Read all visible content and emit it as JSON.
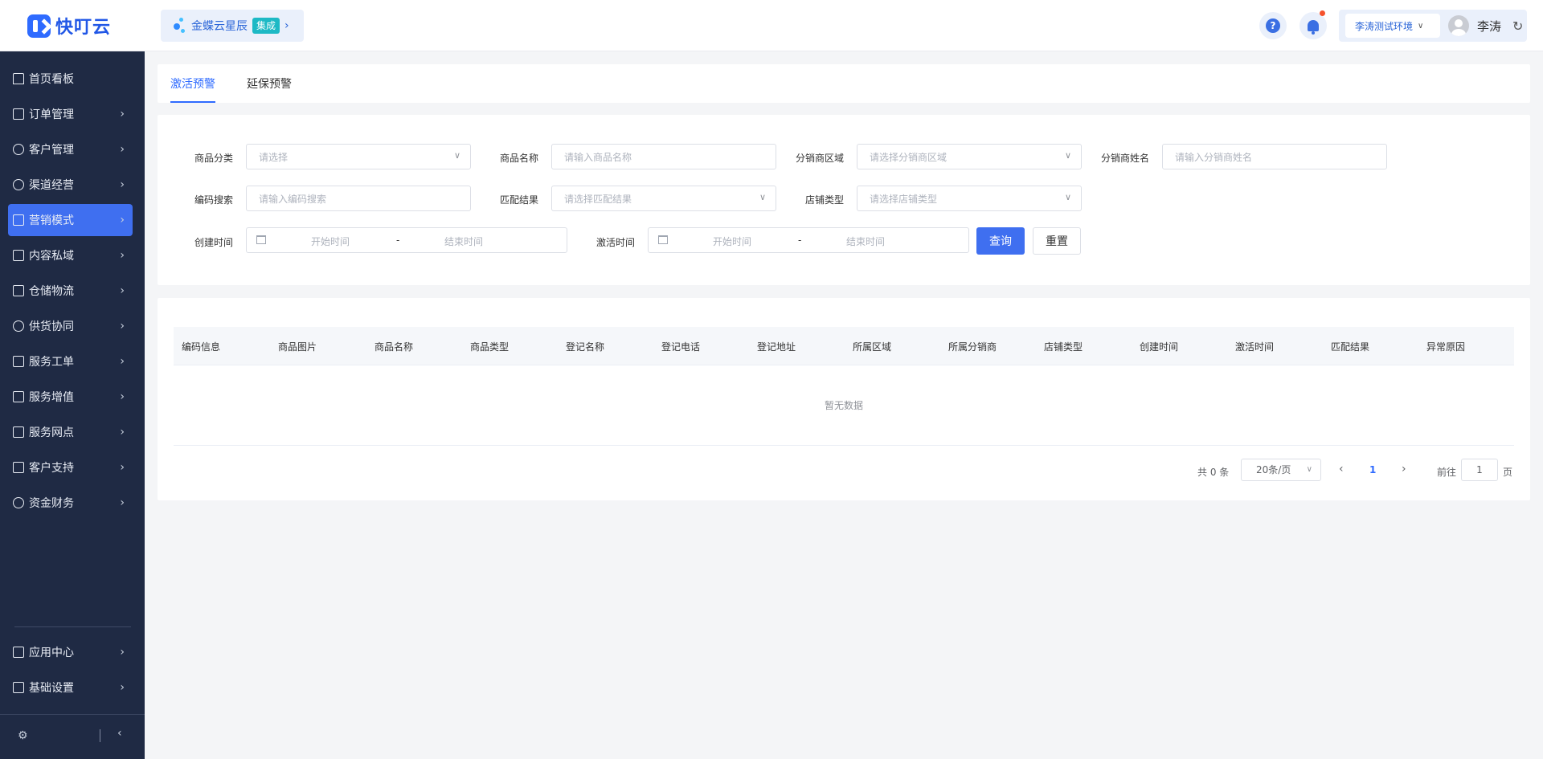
{
  "header": {
    "logo_text": "快叮云",
    "app_name": "金蝶云星辰",
    "app_tag": "集成",
    "env": "李涛测试环境",
    "username": "李涛"
  },
  "sidebar": {
    "items": [
      {
        "label": "首页看板",
        "icon": "home-icon"
      },
      {
        "label": "订单管理",
        "icon": "order-icon"
      },
      {
        "label": "客户管理",
        "icon": "user-icon"
      },
      {
        "label": "渠道经营",
        "icon": "channel-icon"
      },
      {
        "label": "营销模式",
        "icon": "tag-icon"
      },
      {
        "label": "内容私域",
        "icon": "image-icon"
      },
      {
        "label": "仓储物流",
        "icon": "box-icon"
      },
      {
        "label": "供货协同",
        "icon": "supply-icon"
      },
      {
        "label": "服务工单",
        "icon": "ticket-icon"
      },
      {
        "label": "服务增值",
        "icon": "bag-icon"
      },
      {
        "label": "服务网点",
        "icon": "store-icon"
      },
      {
        "label": "客户支持",
        "icon": "support-icon"
      },
      {
        "label": "资金财务",
        "icon": "yuan-icon"
      }
    ],
    "bottom_items": [
      {
        "label": "应用中心",
        "icon": "cube-icon"
      },
      {
        "label": "基础设置",
        "icon": "settings-icon"
      }
    ],
    "active_index": 4
  },
  "tabs": [
    "激活预警",
    "延保预警"
  ],
  "filters": {
    "category": {
      "label": "商品分类",
      "placeholder": "请选择"
    },
    "product_name": {
      "label": "商品名称",
      "placeholder": "请输入商品名称"
    },
    "region": {
      "label": "分销商区域",
      "placeholder": "请选择分销商区域"
    },
    "distributor_name": {
      "label": "分销商姓名",
      "placeholder": "请输入分销商姓名"
    },
    "code_search": {
      "label": "编码搜索",
      "placeholder": "请输入编码搜索"
    },
    "match_result": {
      "label": "匹配结果",
      "placeholder": "请选择匹配结果"
    },
    "store_type": {
      "label": "店铺类型",
      "placeholder": "请选择店铺类型"
    },
    "created_time": {
      "label": "创建时间",
      "start": "开始时间",
      "sep": "-",
      "end": "结束时间"
    },
    "activated_time": {
      "label": "激活时间",
      "start": "开始时间",
      "sep": "-",
      "end": "结束时间"
    },
    "query_button": "查询",
    "reset_button": "重置"
  },
  "table": {
    "columns": [
      "编码信息",
      "商品图片",
      "商品名称",
      "商品类型",
      "登记名称",
      "登记电话",
      "登记地址",
      "所属区域",
      "所属分销商",
      "店铺类型",
      "创建时间",
      "激活时间",
      "匹配结果",
      "异常原因"
    ],
    "empty_text": "暂无数据"
  },
  "pagination": {
    "total_text": "共 0 条",
    "page_size": "20条/页",
    "current_page": "1",
    "goto_label": "前往",
    "goto_value": "1",
    "goto_suffix": "页"
  }
}
